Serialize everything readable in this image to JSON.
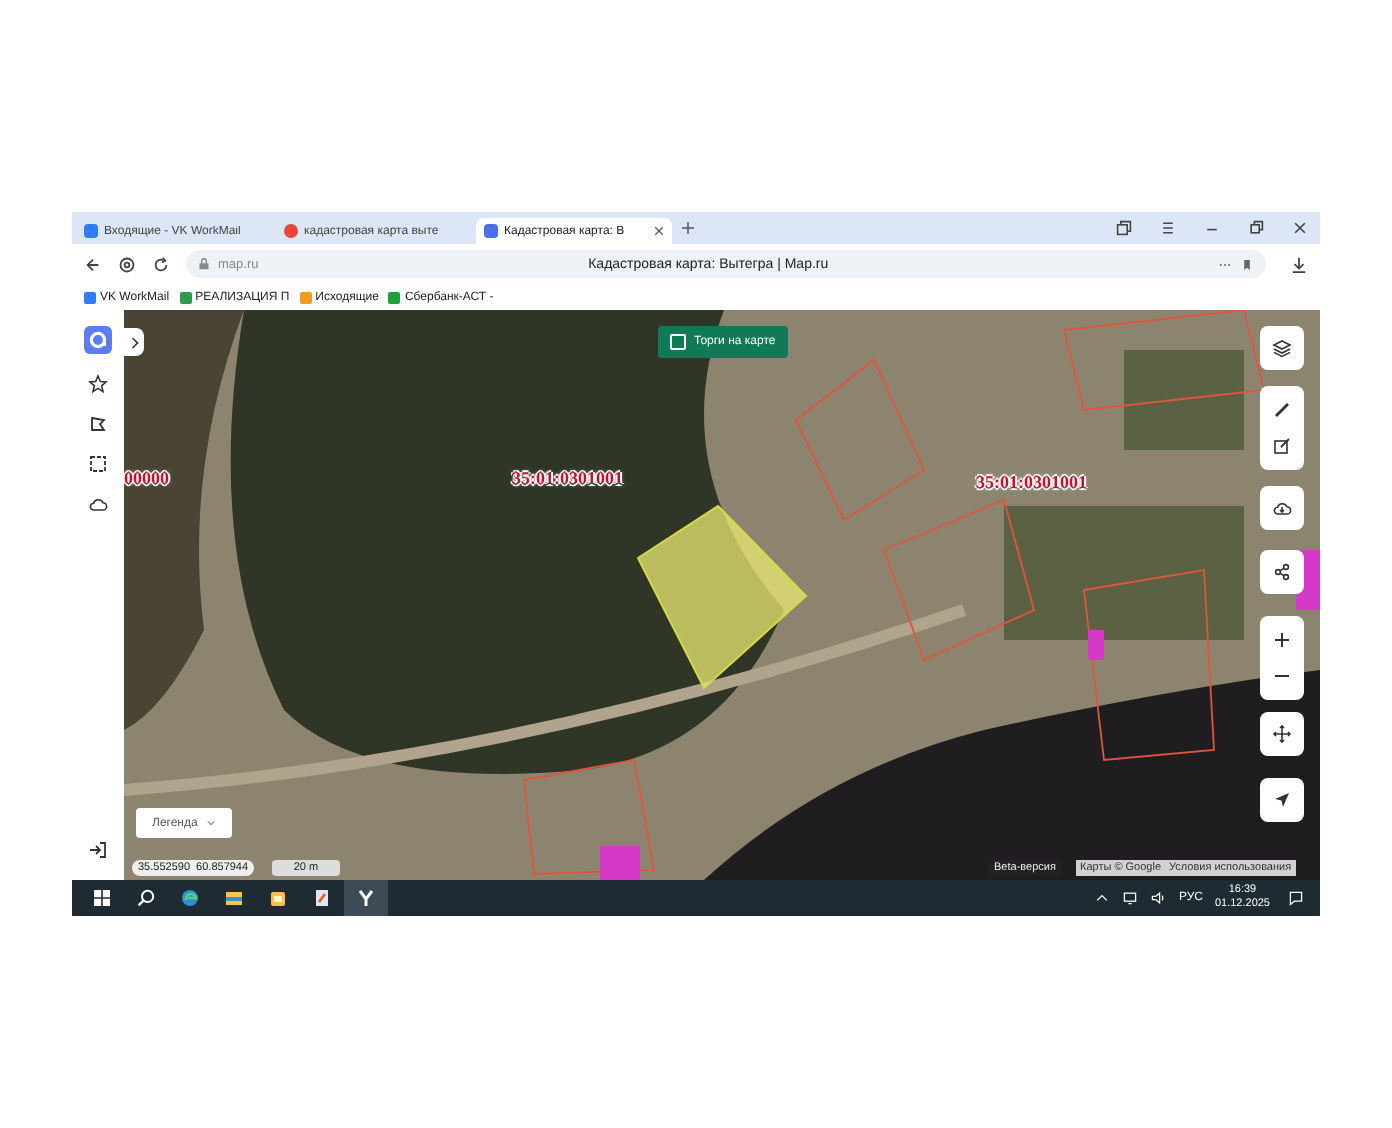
{
  "tabs": [
    {
      "title": "Входящие - VK WorkMail",
      "selected": false
    },
    {
      "title": "кадастровая карта выте",
      "selected": false
    },
    {
      "title": "Кадастровая карта: В",
      "selected": true
    }
  ],
  "address_bar": {
    "url": "map.ru",
    "page_title": "Кадастровая карта: Вытегра | Map.ru"
  },
  "bookmarks": [
    {
      "label": "VK WorkMail"
    },
    {
      "label": "РЕАЛИЗАЦИЯ П"
    },
    {
      "label": "Исходящие"
    },
    {
      "label": "Сбербанк-АСТ -"
    }
  ],
  "map": {
    "promo_toggle": {
      "label": "Торги на карте",
      "checked": false
    },
    "parcel_labels": [
      "00000",
      "35:01:0301001",
      "35:01:0301001"
    ],
    "legend_button": "Легенда",
    "coordinates": "35.552590  60.857944",
    "scale": "20 m",
    "beta_badge": "Beta-версия",
    "attribution": "Карты © Google",
    "terms_link": "Условия использования"
  },
  "taskbar": {
    "language": "РУС",
    "time": "16:39",
    "date": "01.12.2025"
  }
}
